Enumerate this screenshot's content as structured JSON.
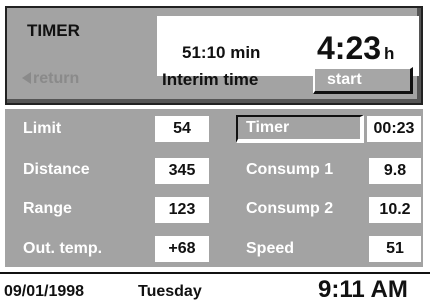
{
  "header": {
    "title": "TIMER",
    "interim_value": "51:10 min",
    "main_time": "4:23",
    "main_unit": "h",
    "return_label": "return",
    "interim_label": "Interim time",
    "start_label": "start"
  },
  "left_rows": [
    {
      "label": "Limit",
      "value": "54"
    },
    {
      "label": "Distance",
      "value": "345"
    },
    {
      "label": "Range",
      "value": "123"
    },
    {
      "label": "Out. temp.",
      "value": "+68"
    }
  ],
  "right_rows": [
    {
      "label": "Timer",
      "value": "00:23"
    },
    {
      "label": "Consump 1",
      "value": "9.8"
    },
    {
      "label": "Consump 2",
      "value": "10.2"
    },
    {
      "label": "Speed",
      "value": "51"
    }
  ],
  "status": {
    "date": "09/01/1998",
    "day": "Tuesday",
    "time": "9:11 AM"
  },
  "colors": {
    "panel": "#a3a3a3",
    "dimmed_text": "#8a8a8a"
  }
}
